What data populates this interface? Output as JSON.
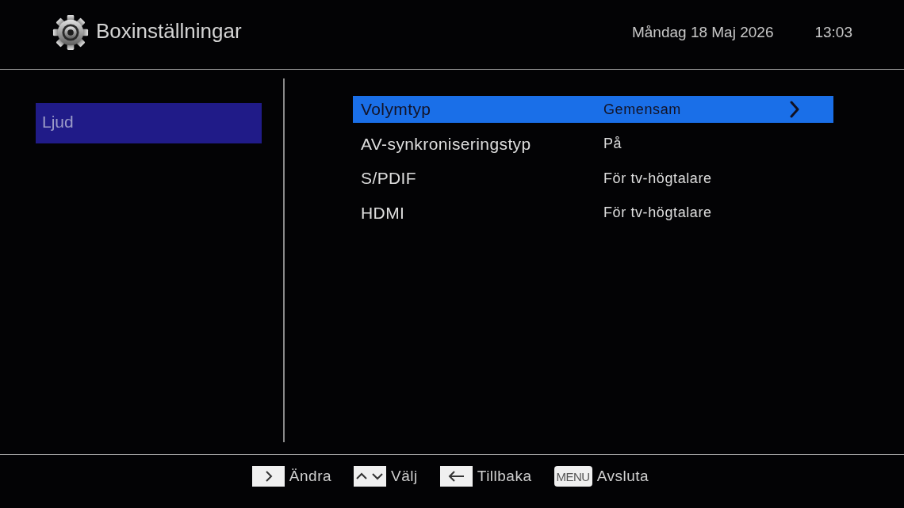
{
  "header": {
    "title": "Boxinställningar",
    "date": "Måndag 18 Maj 2026",
    "time": "13:03"
  },
  "sidebar": {
    "items": [
      {
        "label": "Ljud",
        "selected": true
      }
    ]
  },
  "settings": [
    {
      "label": "Volymtyp",
      "value": "Gemensam",
      "selected": true
    },
    {
      "label": "AV-synkroniseringstyp",
      "value": "På",
      "selected": false
    },
    {
      "label": "S/PDIF",
      "value": "För tv-högtalare",
      "selected": false
    },
    {
      "label": "HDMI",
      "value": "För tv-högtalare",
      "selected": false
    }
  ],
  "hints": [
    {
      "kind": "right",
      "label": "Ändra"
    },
    {
      "kind": "updown",
      "label": "Välj"
    },
    {
      "kind": "left",
      "label": "Tillbaka"
    },
    {
      "kind": "text",
      "key_text": "MENU",
      "label": "Avsluta"
    }
  ]
}
